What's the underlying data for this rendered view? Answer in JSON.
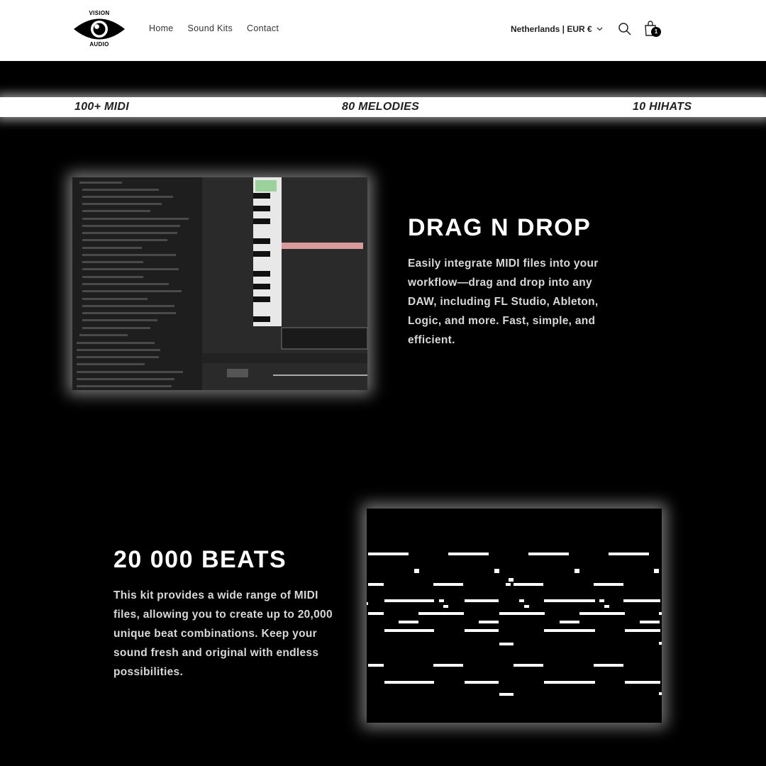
{
  "header": {
    "logo": {
      "top_text": "VISION",
      "bottom_text": "AUDIO"
    },
    "nav": [
      {
        "label": "Home"
      },
      {
        "label": "Sound Kits"
      },
      {
        "label": "Contact"
      }
    ],
    "locale": "Netherlands | EUR €",
    "cart_count": "1",
    "icons": [
      "eye-logo-icon",
      "chevron-down-icon",
      "search-icon",
      "shopping-bag-icon"
    ]
  },
  "ticker": {
    "items": [
      "100+ MIDI",
      "80 MELODIES",
      "10 HIHATS"
    ]
  },
  "features": [
    {
      "title": "DRAG N DROP",
      "text": "Easily integrate MIDI files into your workflow—drag and drop into any DAW, including FL Studio, Ableton, Logic, and more. Fast, simple, and efficient."
    },
    {
      "title": "20 000 BEATS",
      "text": "This kit provides a wide range of MIDI files, allowing you to create up to 20,000 unique beat combinations. Keep your sound fresh and original with endless possibilities."
    }
  ],
  "colors": {
    "background": "#000000",
    "header": "#ffffff",
    "text_primary": "#ffffff",
    "text_secondary": "#d8d8d8"
  }
}
